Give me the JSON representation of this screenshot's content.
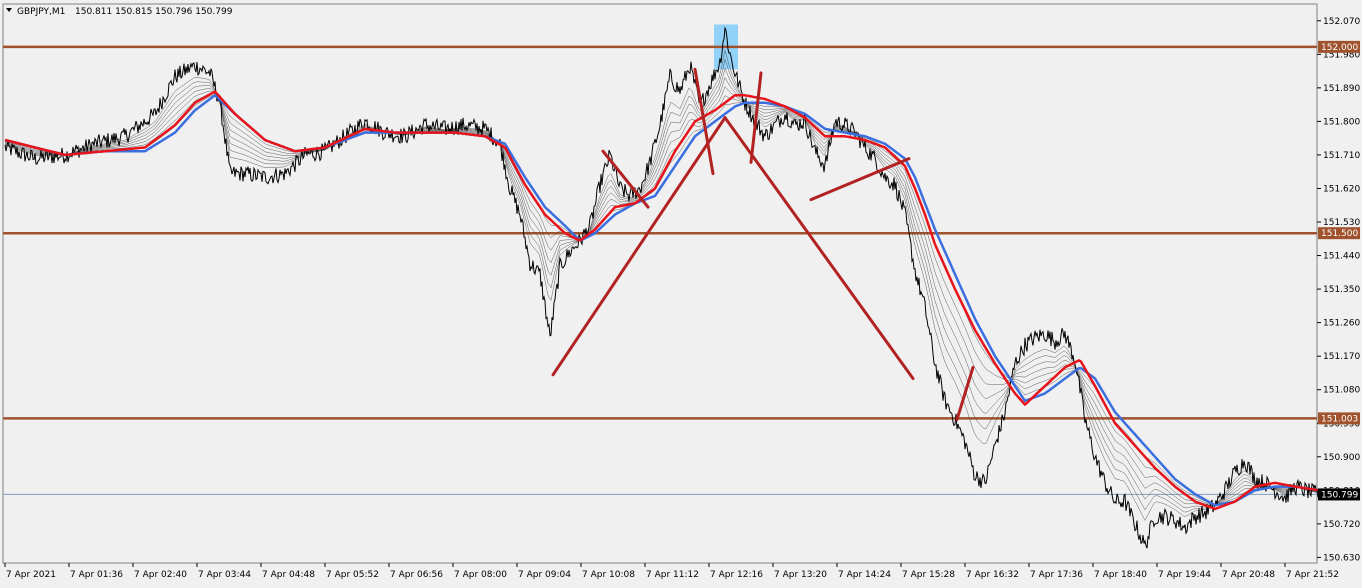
{
  "header": {
    "menu_icon": "triangle-down-icon",
    "symbol": "GBPJPY,M1",
    "ohlc": "150.811 150.815 150.796 150.799"
  },
  "colors": {
    "background": "#f0f0f0",
    "price": "#000000",
    "ema_fast": "#e8141b",
    "ema_slow": "#3b6fe0",
    "hline": "#a0522d",
    "annotation": "#b22222",
    "highlight": "#87cefa",
    "current_line": "#7f9fbf"
  },
  "chart_data": {
    "type": "line",
    "title": "GBPJPY,M1",
    "ylim": [
      150.6,
      152.1
    ],
    "y_ticks": [
      "152.070",
      "151.980",
      "151.890",
      "151.800",
      "151.710",
      "151.620",
      "151.530",
      "151.440",
      "151.350",
      "151.260",
      "151.170",
      "151.080",
      "150.990",
      "150.900",
      "150.810",
      "150.720",
      "150.630"
    ],
    "x_ticks": [
      "7 Apr 2021",
      "7 Apr 01:36",
      "7 Apr 02:40",
      "7 Apr 03:44",
      "7 Apr 04:48",
      "7 Apr 05:52",
      "7 Apr 06:56",
      "7 Apr 08:00",
      "7 Apr 09:04",
      "7 Apr 10:08",
      "7 Apr 11:12",
      "7 Apr 12:16",
      "7 Apr 13:20",
      "7 Apr 14:24",
      "7 Apr 15:28",
      "7 Apr 16:32",
      "7 Apr 17:36",
      "7 Apr 18:40",
      "7 Apr 19:44",
      "7 Apr 20:48",
      "7 Apr 21:52"
    ],
    "x_index": [
      0,
      64,
      128,
      192,
      256,
      320,
      384,
      448,
      512,
      576,
      640,
      704,
      768,
      832,
      896,
      960,
      1024,
      1088,
      1152,
      1216,
      1280
    ],
    "x_range": [
      0,
      1314
    ],
    "price_series": {
      "name": "GBPJPY",
      "x": [
        0,
        30,
        60,
        90,
        120,
        150,
        170,
        190,
        205,
        215,
        225,
        240,
        260,
        280,
        300,
        320,
        340,
        360,
        380,
        400,
        420,
        440,
        460,
        480,
        495,
        505,
        515,
        525,
        535,
        545,
        555,
        565,
        575,
        585,
        595,
        605,
        615,
        625,
        635,
        645,
        655,
        665,
        675,
        685,
        695,
        705,
        715,
        720,
        725,
        730,
        740,
        750,
        760,
        770,
        780,
        790,
        800,
        810,
        820,
        830,
        840,
        850,
        860,
        870,
        880,
        890,
        900,
        910,
        920,
        930,
        940,
        950,
        960,
        970,
        980,
        990,
        1000,
        1010,
        1020,
        1030,
        1040,
        1050,
        1060,
        1070,
        1080,
        1090,
        1100,
        1110,
        1120,
        1130,
        1140,
        1150,
        1160,
        1170,
        1180,
        1190,
        1200,
        1210,
        1220,
        1230,
        1240,
        1250,
        1260,
        1270,
        1280,
        1290,
        1300,
        1314
      ],
      "y": [
        151.73,
        151.7,
        151.71,
        151.74,
        151.76,
        151.82,
        151.92,
        151.95,
        151.93,
        151.85,
        151.66,
        151.66,
        151.65,
        151.66,
        151.71,
        151.72,
        151.76,
        151.8,
        151.77,
        151.76,
        151.79,
        151.78,
        151.79,
        151.78,
        151.74,
        151.62,
        151.55,
        151.42,
        151.39,
        151.22,
        151.41,
        151.45,
        151.48,
        151.52,
        151.63,
        151.71,
        151.62,
        151.6,
        151.62,
        151.69,
        151.79,
        151.92,
        151.88,
        151.95,
        151.84,
        151.9,
        151.96,
        152.05,
        151.98,
        151.93,
        151.85,
        151.8,
        151.76,
        151.79,
        151.82,
        151.79,
        151.8,
        151.72,
        151.68,
        151.8,
        151.79,
        151.77,
        151.73,
        151.7,
        151.65,
        151.63,
        151.55,
        151.4,
        151.3,
        151.15,
        151.05,
        151.0,
        150.94,
        150.85,
        150.83,
        150.93,
        151.02,
        151.15,
        151.2,
        151.22,
        151.23,
        151.21,
        151.23,
        151.16,
        151.0,
        150.9,
        150.83,
        150.78,
        150.78,
        150.72,
        150.66,
        150.74,
        150.74,
        150.73,
        150.71,
        150.74,
        150.75,
        150.77,
        150.81,
        150.86,
        150.89,
        150.84,
        150.83,
        150.81,
        150.79,
        150.82,
        150.81,
        150.8
      ]
    },
    "ema_fast": {
      "x": [
        0,
        60,
        100,
        140,
        170,
        190,
        210,
        230,
        260,
        290,
        320,
        360,
        390,
        420,
        450,
        480,
        500,
        520,
        540,
        560,
        575,
        590,
        610,
        630,
        650,
        670,
        690,
        710,
        730,
        740,
        760,
        780,
        800,
        820,
        840,
        860,
        880,
        900,
        910,
        920,
        930,
        950,
        970,
        990,
        1010,
        1020,
        1040,
        1060,
        1075,
        1090,
        1110,
        1130,
        1150,
        1170,
        1190,
        1210,
        1230,
        1250,
        1270,
        1290,
        1314
      ],
      "y": [
        151.75,
        151.71,
        151.72,
        151.73,
        151.79,
        151.85,
        151.88,
        151.82,
        151.75,
        151.72,
        151.73,
        151.78,
        151.77,
        151.77,
        151.77,
        151.76,
        151.73,
        151.63,
        151.55,
        151.5,
        151.48,
        151.51,
        151.57,
        151.58,
        151.62,
        151.72,
        151.8,
        151.83,
        151.87,
        151.87,
        151.86,
        151.84,
        151.81,
        151.76,
        151.76,
        151.75,
        151.73,
        151.68,
        151.62,
        151.55,
        151.47,
        151.35,
        151.24,
        151.15,
        151.07,
        151.04,
        151.09,
        151.14,
        151.16,
        151.09,
        150.99,
        150.93,
        150.87,
        150.82,
        150.78,
        150.76,
        150.78,
        150.82,
        150.83,
        150.82,
        150.81
      ]
    },
    "ema_slow": {
      "x": [
        0,
        60,
        100,
        140,
        170,
        190,
        210,
        230,
        260,
        290,
        320,
        360,
        390,
        420,
        450,
        480,
        500,
        520,
        540,
        560,
        575,
        590,
        610,
        630,
        650,
        670,
        690,
        710,
        730,
        740,
        760,
        780,
        800,
        820,
        840,
        860,
        880,
        900,
        910,
        920,
        930,
        950,
        970,
        990,
        1010,
        1020,
        1040,
        1060,
        1075,
        1090,
        1110,
        1130,
        1150,
        1170,
        1190,
        1210,
        1230,
        1250,
        1270,
        1290,
        1314
      ],
      "y": [
        151.75,
        151.71,
        151.72,
        151.72,
        151.77,
        151.83,
        151.87,
        151.82,
        151.75,
        151.72,
        151.73,
        151.77,
        151.77,
        151.77,
        151.77,
        151.76,
        151.74,
        151.65,
        151.57,
        151.52,
        151.48,
        151.5,
        151.55,
        151.58,
        151.6,
        151.68,
        151.76,
        151.8,
        151.84,
        151.85,
        151.85,
        151.84,
        151.82,
        151.78,
        151.77,
        151.76,
        151.74,
        151.7,
        151.65,
        151.58,
        151.51,
        151.39,
        151.27,
        151.17,
        151.09,
        151.05,
        151.07,
        151.11,
        151.14,
        151.11,
        151.02,
        150.96,
        150.9,
        150.84,
        150.8,
        150.77,
        150.78,
        150.81,
        150.82,
        150.82,
        150.81
      ]
    },
    "hlines": [
      {
        "y": 152.0,
        "label": "152.000"
      },
      {
        "y": 151.5,
        "label": "151.500"
      },
      {
        "y": 151.003,
        "label": "151.003"
      }
    ],
    "current_price": {
      "y": 150.799,
      "label": "150.799"
    },
    "trend_lines": [
      {
        "x1": 548,
        "y1": 151.12,
        "x2": 720,
        "y2": 151.81
      },
      {
        "x1": 720,
        "y1": 151.81,
        "x2": 908,
        "y2": 151.11
      },
      {
        "x1": 598,
        "y1": 151.72,
        "x2": 643,
        "y2": 151.57
      },
      {
        "x1": 690,
        "y1": 151.94,
        "x2": 708,
        "y2": 151.66
      },
      {
        "x1": 746,
        "y1": 151.69,
        "x2": 756,
        "y2": 151.93
      },
      {
        "x1": 806,
        "y1": 151.59,
        "x2": 904,
        "y2": 151.7
      },
      {
        "x1": 952,
        "y1": 151.0,
        "x2": 968,
        "y2": 151.14
      }
    ],
    "highlight": {
      "x1": 709,
      "x2": 733,
      "y1": 151.94,
      "y2": 152.06
    },
    "grid": false
  }
}
